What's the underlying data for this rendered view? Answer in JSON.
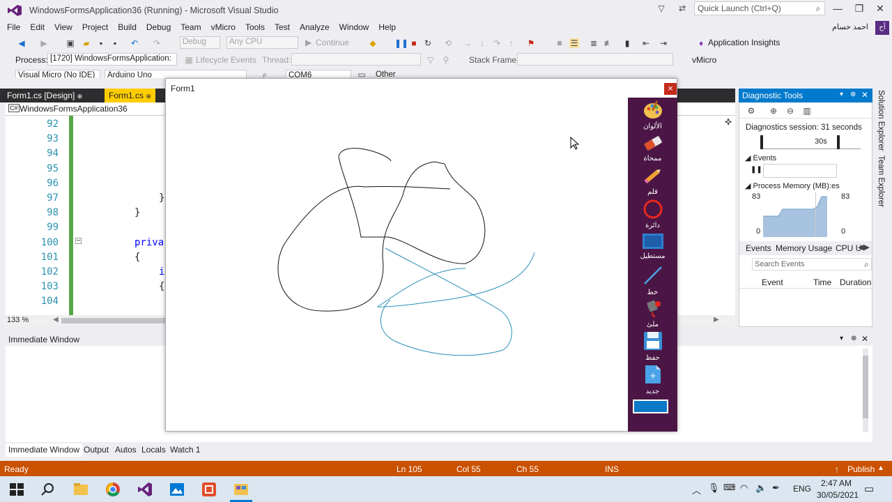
{
  "window": {
    "title": "WindowsFormsApplication36 (Running) - Microsoft Visual Studio",
    "quick_launch": "Quick Launch (Ctrl+Q)",
    "user": "احمد حسام",
    "avatar": "أح"
  },
  "menu": [
    "File",
    "Edit",
    "View",
    "Project",
    "Build",
    "Debug",
    "Team",
    "vMicro",
    "Tools",
    "Test",
    "Analyze",
    "Window",
    "Help"
  ],
  "toolbar1": {
    "config": "Debug",
    "platform": "Any CPU",
    "continue": "Continue",
    "insights": "Application Insights"
  },
  "toolbar2": {
    "process_label": "Process:",
    "process": "[1720] WindowsFormsApplication:",
    "lifecycle": "Lifecycle Events",
    "thread_label": "Thread:",
    "stack_label": "Stack Frame:",
    "vmicro": "vMicro"
  },
  "toolbar3": {
    "micro": "Visual Micro (No IDE)",
    "board": "Arduino Uno",
    "port": "COM6",
    "other": "Other"
  },
  "doc_tabs": [
    "Form1.cs [Design]",
    "Form1.cs"
  ],
  "nav_project": "WindowsFormsApplication36",
  "code_lines": [
    {
      "n": "92",
      "t": ""
    },
    {
      "n": "93",
      "t": ""
    },
    {
      "n": "94",
      "t": ""
    },
    {
      "n": "95",
      "t": ""
    },
    {
      "n": "96",
      "t": ""
    },
    {
      "n": "97",
      "t": "}"
    },
    {
      "n": "98",
      "t": "}"
    },
    {
      "n": "99",
      "t": ""
    },
    {
      "n": "100",
      "t": "priva"
    },
    {
      "n": "101",
      "t": "{"
    },
    {
      "n": "102",
      "t": "i"
    },
    {
      "n": "103",
      "t": "{"
    },
    {
      "n": "104",
      "t": ""
    }
  ],
  "zoom": "133 %",
  "form": {
    "title": "Form1",
    "close": "×"
  },
  "tools": [
    {
      "icon": "palette-icon",
      "label": "الألوان"
    },
    {
      "icon": "eraser-icon",
      "label": "ممحاة"
    },
    {
      "icon": "pencil-icon",
      "label": "قلم"
    },
    {
      "icon": "circle-icon",
      "label": "دائرة"
    },
    {
      "icon": "rectangle-icon",
      "label": "مستطيل"
    },
    {
      "icon": "line-icon",
      "label": "خط"
    },
    {
      "icon": "fill-icon",
      "label": "ملئ"
    },
    {
      "icon": "save-icon",
      "label": "حفظ"
    },
    {
      "icon": "new-file-icon",
      "label": "جديد"
    }
  ],
  "current_color": "#0d79c8",
  "diagnostic": {
    "title": "Diagnostic Tools",
    "session": "Diagnostics session: 31 seconds",
    "timeline": "30s",
    "events": "Events",
    "memory": "Process Memory (MB)",
    "mem_extra": ":es",
    "mem_max_left": "83",
    "mem_max_right": "83",
    "mem_min_left": "0",
    "mem_min_right": "0",
    "tabs": [
      "Events",
      "Memory Usage",
      "CPU U"
    ],
    "search": "Search Events",
    "cols": [
      "Event",
      "Time",
      "Duration"
    ]
  },
  "immediate": {
    "title": "Immediate Window"
  },
  "bottom_tabs": [
    "Immediate Window",
    "Output",
    "Autos",
    "Locals",
    "Watch 1"
  ],
  "status": {
    "ready": "Ready",
    "ln": "Ln 105",
    "col": "Col 55",
    "ch": "Ch 55",
    "ins": "INS",
    "publish": "Publish"
  },
  "side_tabs": [
    "Solution Explorer",
    "Team Explorer"
  ],
  "tray": {
    "lang": "ENG",
    "time": "2:47 AM",
    "date": "30/05/2021"
  }
}
